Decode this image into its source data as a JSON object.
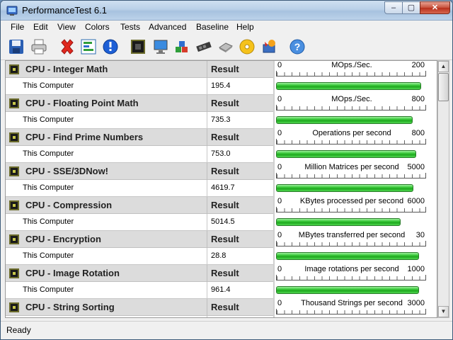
{
  "window": {
    "title": "PerformanceTest 6.1"
  },
  "menu": [
    "File",
    "Edit",
    "View",
    "Colors",
    "Tests",
    "Advanced",
    "Baseline",
    "Help"
  ],
  "toolbar_icons": [
    "save-icon",
    "print-icon",
    "delete-icon",
    "graph-icon",
    "info-icon",
    "stop-icon",
    "monitor-icon",
    "cubes-icon",
    "memory-icon",
    "disk-icon",
    "cd-icon",
    "advanced-icon",
    "help-icon"
  ],
  "column_result_label": "Result",
  "system_label": "This Computer",
  "tests": [
    {
      "name": "CPU - Integer Math",
      "result": "195.4",
      "unit": "MOps./Sec.",
      "min": "0",
      "max": "200",
      "fraction": 0.977
    },
    {
      "name": "CPU - Floating Point Math",
      "result": "735.3",
      "unit": "MOps./Sec.",
      "min": "0",
      "max": "800",
      "fraction": 0.919
    },
    {
      "name": "CPU - Find Prime Numbers",
      "result": "753.0",
      "unit": "Operations per second",
      "min": "0",
      "max": "800",
      "fraction": 0.941
    },
    {
      "name": "CPU - SSE/3DNow!",
      "result": "4619.7",
      "unit": "Million Matrices per second",
      "min": "0",
      "max": "5000",
      "fraction": 0.924
    },
    {
      "name": "CPU - Compression",
      "result": "5014.5",
      "unit": "KBytes processed per second",
      "min": "0",
      "max": "6000",
      "fraction": 0.836
    },
    {
      "name": "CPU - Encryption",
      "result": "28.8",
      "unit": "MBytes transferred per second",
      "min": "0",
      "max": "30",
      "fraction": 0.96
    },
    {
      "name": "CPU - Image Rotation",
      "result": "961.4",
      "unit": "Image rotations per second",
      "min": "0",
      "max": "1000",
      "fraction": 0.961
    },
    {
      "name": "CPU - String Sorting",
      "result": "",
      "unit": "Thousand Strings per second",
      "min": "0",
      "max": "3000",
      "fraction": null
    }
  ],
  "status": "Ready",
  "colors": {
    "bar_green": "#36c636",
    "header_gray": "#dcdcdc",
    "titlebar_blue": "#b9d0e8"
  }
}
